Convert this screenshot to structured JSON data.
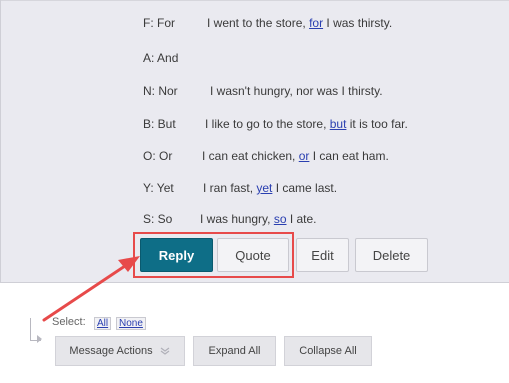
{
  "conjunctions": [
    {
      "key": "F: For",
      "before": "I went to the store, ",
      "link": "for",
      "after": " I was thirsty."
    },
    {
      "key": "A: And",
      "before": "",
      "link": "",
      "after": ""
    },
    {
      "key": "N: Nor",
      "before": "I wasn't hungry, nor was I thirsty.",
      "link": "",
      "after": ""
    },
    {
      "key": "B: But",
      "before": "I like to go to the store, ",
      "link": "but",
      "after": " it is too far."
    },
    {
      "key": "O: Or",
      "before": "I can eat chicken, ",
      "link": "or",
      "after": " I can eat ham."
    },
    {
      "key": "Y: Yet",
      "before": "I ran fast, ",
      "link": "yet",
      "after": " I came last."
    },
    {
      "key": "S: So",
      "before": "I was hungry, ",
      "link": "so",
      "after": " I ate."
    }
  ],
  "post_buttons": {
    "reply": "Reply",
    "quote": "Quote",
    "edit": "Edit",
    "delete": "Delete"
  },
  "annotation_color": "#e74a4a",
  "footer": {
    "select_label": "Select:",
    "select_all": "All",
    "select_none": "None",
    "message_actions": "Message Actions",
    "message_actions_icon": "chevron-down-icon",
    "expand_all": "Expand All",
    "collapse_all": "Collapse All"
  }
}
